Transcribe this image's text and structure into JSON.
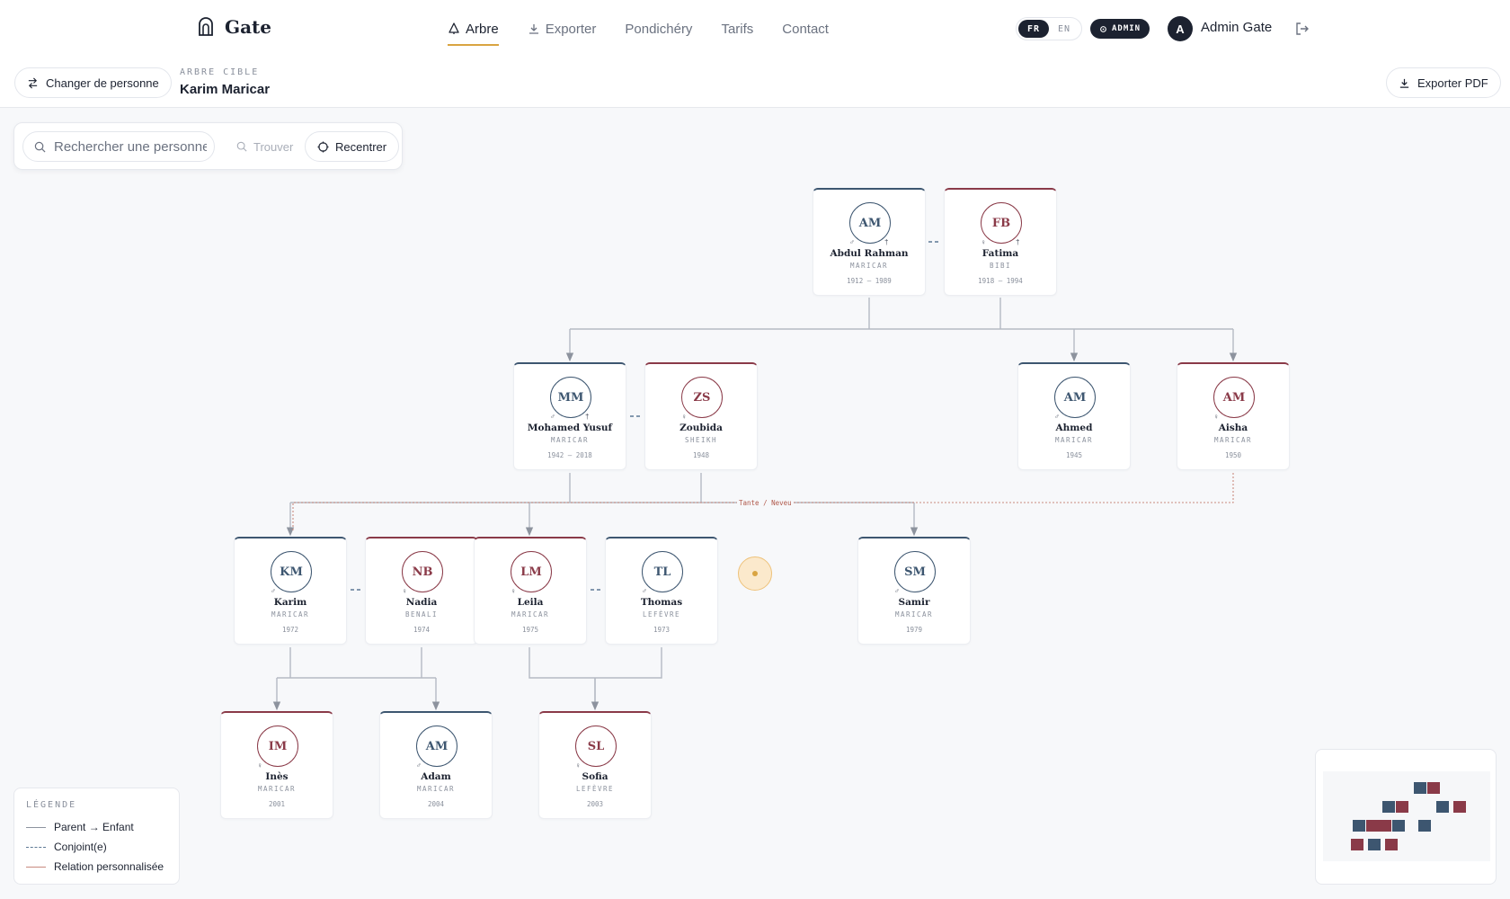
{
  "brand": {
    "name": "Gate"
  },
  "nav": {
    "items": [
      {
        "label": "Arbre",
        "icon": "tree-icon",
        "active": true
      },
      {
        "label": "Exporter",
        "icon": "download-icon",
        "active": false
      },
      {
        "label": "Pondichéry",
        "active": false
      },
      {
        "label": "Tarifs",
        "active": false
      },
      {
        "label": "Contact",
        "active": false
      }
    ]
  },
  "lang": {
    "fr": "FR",
    "en": "EN",
    "selected": "FR"
  },
  "admin_badge": "ADMIN",
  "user": {
    "initial": "A",
    "name": "Admin Gate"
  },
  "subbar": {
    "change_person": "Changer de personne",
    "target_label": "ARBRE CIBLE",
    "target_name": "Karim Maricar",
    "export_pdf": "Exporter PDF"
  },
  "search": {
    "placeholder": "Rechercher une personne",
    "find_label": "Trouver",
    "recenter_label": "Recentrer"
  },
  "people": [
    {
      "id": "abdul",
      "initials": "AM",
      "first": "Abdul Rahman",
      "last": "MARICAR",
      "dates": "1912 – 1989",
      "gender": "m",
      "deceased": true
    },
    {
      "id": "fatima",
      "initials": "FB",
      "first": "Fatima",
      "last": "BIBI",
      "dates": "1918 – 1994",
      "gender": "f",
      "deceased": true
    },
    {
      "id": "yusuf",
      "initials": "MM",
      "first": "Mohamed Yusuf",
      "last": "MARICAR",
      "dates": "1942 – 2018",
      "gender": "m",
      "deceased": true
    },
    {
      "id": "zoubida",
      "initials": "ZS",
      "first": "Zoubida",
      "last": "SHEIKH",
      "dates": "1948",
      "gender": "f",
      "deceased": false
    },
    {
      "id": "ahmed",
      "initials": "AM",
      "first": "Ahmed",
      "last": "MARICAR",
      "dates": "1945",
      "gender": "m",
      "deceased": false
    },
    {
      "id": "aisha",
      "initials": "AM",
      "first": "Aisha",
      "last": "MARICAR",
      "dates": "1950",
      "gender": "f",
      "deceased": false
    },
    {
      "id": "karim",
      "initials": "KM",
      "first": "Karim",
      "last": "MARICAR",
      "dates": "1972",
      "gender": "m",
      "deceased": false
    },
    {
      "id": "nadia",
      "initials": "NB",
      "first": "Nadia",
      "last": "BENALI",
      "dates": "1974",
      "gender": "f",
      "deceased": false
    },
    {
      "id": "leila",
      "initials": "LM",
      "first": "Leila",
      "last": "MARICAR",
      "dates": "1975",
      "gender": "f",
      "deceased": false
    },
    {
      "id": "thomas",
      "initials": "TL",
      "first": "Thomas",
      "last": "LEFÈVRE",
      "dates": "1973",
      "gender": "m",
      "deceased": false
    },
    {
      "id": "samir",
      "initials": "SM",
      "first": "Samir",
      "last": "MARICAR",
      "dates": "1979",
      "gender": "m",
      "deceased": false
    },
    {
      "id": "ines",
      "initials": "IM",
      "first": "Inès",
      "last": "MARICAR",
      "dates": "2001",
      "gender": "f",
      "deceased": false
    },
    {
      "id": "adam",
      "initials": "AM",
      "first": "Adam",
      "last": "MARICAR",
      "dates": "2004",
      "gender": "m",
      "deceased": false
    },
    {
      "id": "sofia",
      "initials": "SL",
      "first": "Sofia",
      "last": "LEFÈVRE",
      "dates": "2003",
      "gender": "f",
      "deceased": false
    }
  ],
  "relation_label": "Tante / Neveu",
  "legend": {
    "title": "LÉGENDE",
    "parent_child": "Parent → Enfant",
    "spouse": "Conjoint(e)",
    "custom": "Relation personnalisée"
  },
  "colors": {
    "male": "#3d5670",
    "female": "#8a3a48",
    "accent": "#d9a441",
    "custom_relation": "#b0584a"
  }
}
